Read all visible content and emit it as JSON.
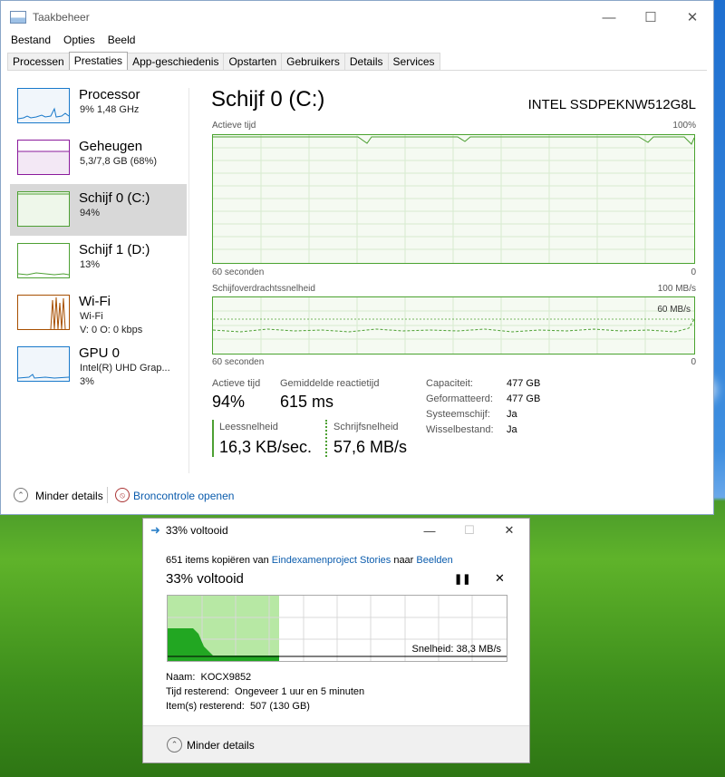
{
  "taskmanager": {
    "title": "Taakbeheer",
    "menu": [
      "Bestand",
      "Opties",
      "Beeld"
    ],
    "tabs": [
      "Processen",
      "Prestaties",
      "App-geschiedenis",
      "Opstarten",
      "Gebruikers",
      "Details",
      "Services"
    ],
    "active_tab": "Prestaties",
    "resources": [
      {
        "name": "Processor",
        "sub": "9% 1,48 GHz",
        "sub2": "",
        "color": "#1979ca"
      },
      {
        "name": "Geheugen",
        "sub": "5,3/7,8 GB (68%)",
        "sub2": "",
        "color": "#8b1a9c"
      },
      {
        "name": "Schijf 0 (C:)",
        "sub": "94%",
        "sub2": "",
        "color": "#4da033"
      },
      {
        "name": "Schijf 1 (D:)",
        "sub": "13%",
        "sub2": "",
        "color": "#4da033"
      },
      {
        "name": "Wi-Fi",
        "sub": "Wi-Fi",
        "sub2": "V: 0 O: 0 kbps",
        "color": "#a74f01"
      },
      {
        "name": "GPU 0",
        "sub": "Intel(R) UHD Grap...",
        "sub2": "3%",
        "color": "#1979ca"
      }
    ],
    "selected_resource": "Schijf 0 (C:)",
    "detail": {
      "title": "Schijf 0 (C:)",
      "model": "INTEL SSDPEKNW512G8L",
      "graph1": {
        "label": "Actieve tijd",
        "max": "100%",
        "time": "60 seconden",
        "min": "0"
      },
      "graph2": {
        "label": "Schijfoverdrachtssnelheid",
        "max": "100 MB/s",
        "inner_label": "60 MB/s",
        "time": "60 seconden",
        "min": "0"
      },
      "stats": {
        "active_label": "Actieve tijd",
        "active_value": "94%",
        "latency_label": "Gemiddelde reactietijd",
        "latency_value": "615 ms",
        "read_label": "Leessnelheid",
        "read_value": "16,3 KB/sec.",
        "write_label": "Schrijfsnelheid",
        "write_value": "57,6 MB/s"
      },
      "properties": [
        {
          "k": "Capaciteit:",
          "v": "477 GB"
        },
        {
          "k": "Geformatteerd:",
          "v": "477 GB"
        },
        {
          "k": "Systeemschijf:",
          "v": "Ja"
        },
        {
          "k": "Wisselbestand:",
          "v": "Ja"
        }
      ]
    },
    "footer": {
      "less_details": "Minder details",
      "resource_monitor": "Broncontrole openen"
    }
  },
  "copy_dialog": {
    "title": "33% voltooid",
    "line_prefix": "651 items kopiëren van ",
    "source": "Eindexamenproject Stories",
    "middle": " naar ",
    "dest": "Beelden",
    "heading": "33% voltooid",
    "progress_fraction": 0.33,
    "speed": "Snelheid: 38,3 MB/s",
    "name_label": "Naam:",
    "name_value": "KOCX9852",
    "time_label": "Tijd resterend:",
    "time_value": "Ongeveer 1 uur en 5 minuten",
    "items_label": "Item(s) resterend:",
    "items_value": "507 (130 GB)",
    "less_details": "Minder details"
  }
}
